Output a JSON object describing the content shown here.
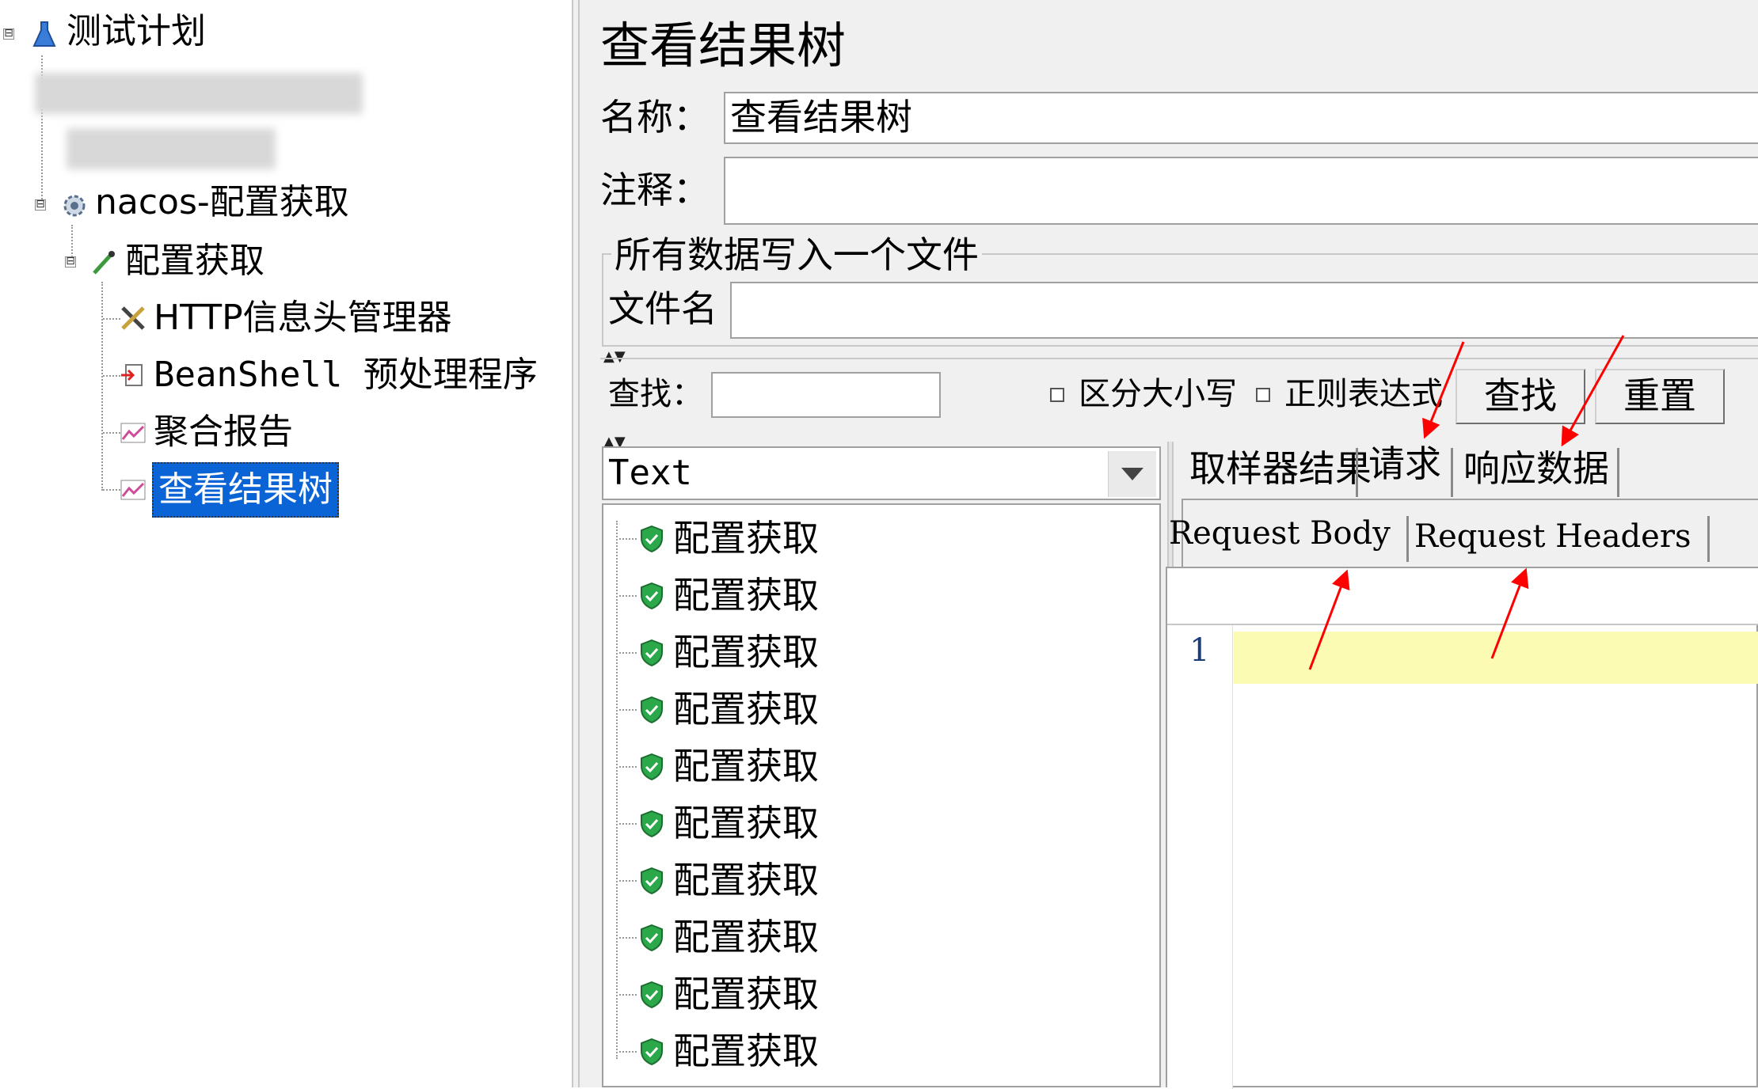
{
  "tree": {
    "root": "测试计划",
    "thread_group": "nacos-配置获取",
    "sampler": "配置获取",
    "children": [
      "HTTP信息头管理器",
      "BeanShell 预处理程序",
      "聚合报告",
      "查看结果树"
    ],
    "expander_symbol": "⊟"
  },
  "panel": {
    "title": "查看结果树",
    "name_label": "名称：",
    "name_value": "查看结果树",
    "comment_label": "注释：",
    "comment_value": "",
    "file_group_title": "所有数据写入一个文件",
    "file_label": "文件名",
    "file_value": ""
  },
  "search": {
    "label": "查找：",
    "value": "",
    "case_label": "区分大小写",
    "regex_label": "正则表达式",
    "find_button": "查找",
    "reset_button": "重置"
  },
  "renderer": {
    "selected": "Text"
  },
  "results": {
    "items": [
      "配置获取",
      "配置获取",
      "配置获取",
      "配置获取",
      "配置获取",
      "配置获取",
      "配置获取",
      "配置获取",
      "配置获取",
      "配置获取"
    ]
  },
  "tabs": {
    "main": [
      "取样器结果",
      "请求",
      "响应数据"
    ],
    "sub": [
      "Request Body",
      "Request Headers"
    ]
  },
  "editor": {
    "line_number": "1"
  },
  "colors": {
    "selection": "#0a64d6",
    "annotation_arrow": "#ff0000",
    "highlight_line": "#fbfbb4",
    "success_shield": "#2aa84a"
  }
}
